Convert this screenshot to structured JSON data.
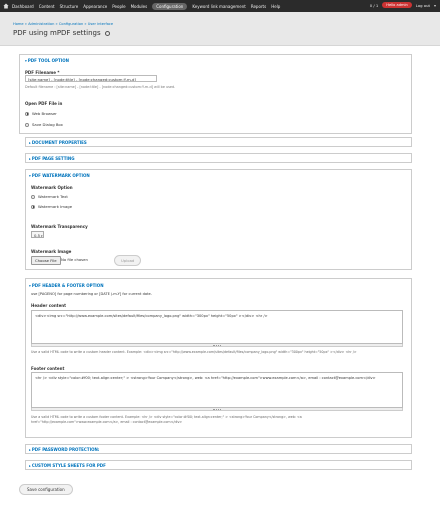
{
  "toolbar": {
    "items": [
      "Dashboard",
      "Content",
      "Structure",
      "Appearance",
      "People",
      "Modules",
      "Configuration",
      "Keyword link management",
      "Reports",
      "Help"
    ],
    "user_counter": "0 / 1",
    "hello": "Hello admin",
    "logout": "Log out"
  },
  "header": {
    "breadcrumb": "Home » Administration » Configuration » User interface",
    "title": "PDF using mPDF settings"
  },
  "pdf_tool": {
    "legend": "PDF TOOL OPTION",
    "filename_label": "PDF Filename *",
    "filename_value": "[site:name] - [node:title] - [node:changed:custom:Y-m-d]",
    "filename_desc": "Default filename : [site:name] - [node:title] - [node:changed:custom:Y-m-d] will be used.",
    "open_label": "Open PDF File in",
    "open_options": [
      "Web Browser",
      "Save Dialog Box"
    ]
  },
  "document_properties": {
    "legend": "DOCUMENT PROPERTIES"
  },
  "page_setting": {
    "legend": "PDF PAGE SETTING"
  },
  "watermark": {
    "legend": "PDF WATERMARK OPTION",
    "option_label": "Watermark Option",
    "options": [
      "Watermark Text",
      "Watermark Image"
    ],
    "transparency_label": "Watermark Transparency",
    "transparency_value": "0.5",
    "image_label": "Watermark Image",
    "choose_file": "Choose File",
    "no_file": "No file chosen",
    "upload": "Upload"
  },
  "header_footer": {
    "legend": "PDF HEADER & FOOTER OPTION",
    "intro": "use [PAGENO] for page numbering or [DATE j-m-Y] for current date.",
    "header_label": "Header content",
    "header_value": "<div><img src=\"http://www.example.com/sites/default/files/company_logo.png\" width=\"300px\" height=\"50px\" ></div> <hr />",
    "header_help": "Use a valid HTML code to write a custom header content. Example: <div><img src=\"http://www.example.com/sites/default/files/company_logo.png\" width=\"300px\" height=\"50px\" ></div> <hr />",
    "footer_label": "Footer content",
    "footer_value": "<hr /> <div style=\"color:#f00; text-align:center;\" > <strong>Your Company</strong>, web: <a href=\"http://example.com\">www.example.com</a>, email : contact@example.com</div>",
    "footer_help_1": "Use a valid HTML code to write a custom footer content. Example: <hr /> <div style=\"color:#f00; text-align:center;\" > <strong>Your Company</strong>, web: <a",
    "footer_help_2": "href=\"http://example.com\">www.example.com</a>, email : contact@example.com</div>"
  },
  "password_protection": {
    "legend": "PDF PASSWORD PROTECTION:"
  },
  "custom_css": {
    "legend": "CUSTOM STYLE SHEETS FOR PDF"
  },
  "save_label": "Save configuration"
}
